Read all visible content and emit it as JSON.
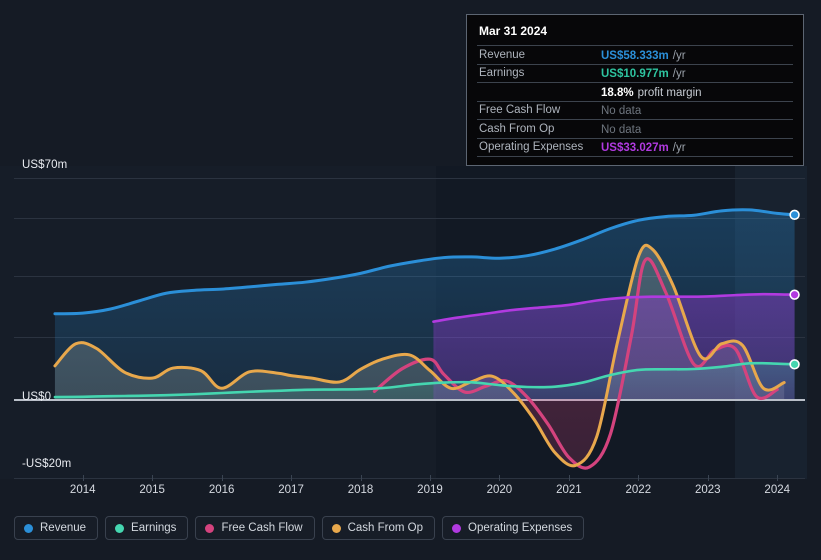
{
  "tooltip": {
    "date": "Mar 31 2024",
    "rows": [
      {
        "label": "Revenue",
        "value": "US$58.333m",
        "unit": "/yr",
        "color": "#2b8fd8"
      },
      {
        "label": "Earnings",
        "value": "US$10.977m",
        "unit": "/yr",
        "color": "#2ec4a0"
      },
      {
        "label": "",
        "value": "18.8%",
        "unit": "profit margin",
        "color": "#ffffff"
      },
      {
        "label": "Free Cash Flow",
        "value": "No data",
        "unit": "",
        "color": "#6e757e"
      },
      {
        "label": "Cash From Op",
        "value": "No data",
        "unit": "",
        "color": "#6e757e"
      },
      {
        "label": "Operating Expenses",
        "value": "US$33.027m",
        "unit": "/yr",
        "color": "#b13ae0"
      }
    ]
  },
  "axis": {
    "y_top_label": "US$70m",
    "y_zero_label": "US$0",
    "y_bottom_label": "-US$20m",
    "x_labels": [
      "2014",
      "2015",
      "2016",
      "2017",
      "2018",
      "2019",
      "2020",
      "2021",
      "2022",
      "2023",
      "2024"
    ]
  },
  "legend": [
    {
      "label": "Revenue",
      "color": "#2b8fd8"
    },
    {
      "label": "Earnings",
      "color": "#45d6b0"
    },
    {
      "label": "Free Cash Flow",
      "color": "#d4437e"
    },
    {
      "label": "Cash From Op",
      "color": "#e8a84c"
    },
    {
      "label": "Operating Expenses",
      "color": "#b13ae0"
    }
  ],
  "chart_data": {
    "type": "area",
    "title": "",
    "xlabel": "",
    "ylabel": "US$",
    "ylim": [
      -20,
      70
    ],
    "xlim": [
      2013.5,
      2024.4
    ],
    "grid": true,
    "legend_position": "bottom-left",
    "y_ticks": [
      70,
      52.5,
      35,
      17.5,
      0,
      -20
    ],
    "x_ticks": [
      2014,
      2015,
      2016,
      2017,
      2018,
      2019,
      2020,
      2021,
      2022,
      2023,
      2024
    ],
    "units": "US$ millions per year",
    "annotations": [
      "Mar 31 2024 hover tooltip at right"
    ],
    "series": [
      {
        "name": "Revenue",
        "color": "#2b8fd8",
        "x": [
          2013.6,
          2014.0,
          2014.4,
          2014.8,
          2015.2,
          2015.6,
          2016.0,
          2016.4,
          2016.8,
          2017.2,
          2017.6,
          2018.0,
          2018.4,
          2018.8,
          2019.2,
          2019.6,
          2020.0,
          2020.4,
          2020.8,
          2021.2,
          2021.6,
          2022.0,
          2022.4,
          2022.8,
          2023.2,
          2023.6,
          2024.0,
          2024.25
        ],
        "y": [
          27.0,
          27.2,
          28.5,
          31.0,
          33.5,
          34.4,
          34.8,
          35.5,
          36.3,
          37.0,
          38.2,
          39.8,
          42.0,
          43.6,
          44.8,
          45.0,
          44.6,
          45.4,
          47.5,
          50.5,
          54.0,
          56.6,
          57.8,
          58.2,
          59.6,
          59.9,
          58.8,
          58.333
        ]
      },
      {
        "name": "Earnings",
        "color": "#45d6b0",
        "x": [
          2013.6,
          2014.0,
          2014.4,
          2014.8,
          2015.2,
          2015.6,
          2016.0,
          2016.4,
          2016.8,
          2017.2,
          2017.6,
          2018.0,
          2018.4,
          2018.8,
          2019.2,
          2019.6,
          2020.0,
          2020.4,
          2020.8,
          2021.2,
          2021.6,
          2022.0,
          2022.4,
          2022.8,
          2023.2,
          2023.6,
          2024.0,
          2024.25
        ],
        "y": [
          0.6,
          0.7,
          0.9,
          1.0,
          1.2,
          1.5,
          1.9,
          2.3,
          2.6,
          2.9,
          3.0,
          3.1,
          3.6,
          4.6,
          5.2,
          5.3,
          4.4,
          3.8,
          3.9,
          5.2,
          7.6,
          9.2,
          9.4,
          9.5,
          10.2,
          11.3,
          11.2,
          10.977
        ]
      },
      {
        "name": "Free Cash Flow",
        "color": "#d4437e",
        "x": [
          2018.2,
          2018.6,
          2019.0,
          2019.2,
          2019.5,
          2019.8,
          2020.1,
          2020.4,
          2020.7,
          2021.0,
          2021.3,
          2021.6,
          2021.9,
          2022.1,
          2022.4,
          2022.8,
          2023.1,
          2023.4,
          2023.7,
          2024.0
        ],
        "y": [
          2.4,
          9.6,
          12.6,
          7.8,
          2.2,
          4.0,
          5.7,
          0.6,
          -8.0,
          -18.5,
          -21.5,
          -11.0,
          20.0,
          44.0,
          33.5,
          11.0,
          15.5,
          15.8,
          0.8,
          3.0
        ]
      },
      {
        "name": "Cash From Op",
        "color": "#e8a84c",
        "x": [
          2013.6,
          2013.9,
          2014.2,
          2014.6,
          2015.0,
          2015.3,
          2015.7,
          2016.0,
          2016.4,
          2016.8,
          2017.0,
          2017.3,
          2017.7,
          2018.0,
          2018.3,
          2018.7,
          2019.0,
          2019.3,
          2019.6,
          2019.9,
          2020.2,
          2020.5,
          2020.8,
          2021.1,
          2021.4,
          2021.7,
          2022.0,
          2022.2,
          2022.5,
          2022.9,
          2023.2,
          2023.5,
          2023.8,
          2024.1
        ],
        "y": [
          10.5,
          17.5,
          16.0,
          8.5,
          6.6,
          9.8,
          9.0,
          3.4,
          8.6,
          8.2,
          7.4,
          6.6,
          5.4,
          9.4,
          12.5,
          14.0,
          9.0,
          3.4,
          5.5,
          7.2,
          2.0,
          -6.5,
          -17.0,
          -21.0,
          -12.0,
          18.0,
          45.0,
          47.5,
          36.0,
          13.5,
          17.5,
          17.0,
          3.4,
          5.2
        ]
      },
      {
        "name": "Operating Expenses",
        "color": "#b13ae0",
        "x": [
          2019.05,
          2019.4,
          2019.8,
          2020.2,
          2020.6,
          2021.0,
          2021.4,
          2021.8,
          2022.2,
          2022.6,
          2023.0,
          2023.4,
          2023.8,
          2024.25
        ],
        "y": [
          24.5,
          25.8,
          27.0,
          28.2,
          29.0,
          29.8,
          31.2,
          32.1,
          32.4,
          32.4,
          32.5,
          32.9,
          33.2,
          33.027
        ]
      }
    ],
    "endpoints": [
      {
        "series": "Revenue",
        "x": 2024.25,
        "y": 58.333,
        "color": "#2b8fd8"
      },
      {
        "series": "Operating Expenses",
        "x": 2024.25,
        "y": 33.027,
        "color": "#b13ae0"
      },
      {
        "series": "Earnings",
        "x": 2024.25,
        "y": 10.977,
        "color": "#45d6b0"
      }
    ]
  }
}
